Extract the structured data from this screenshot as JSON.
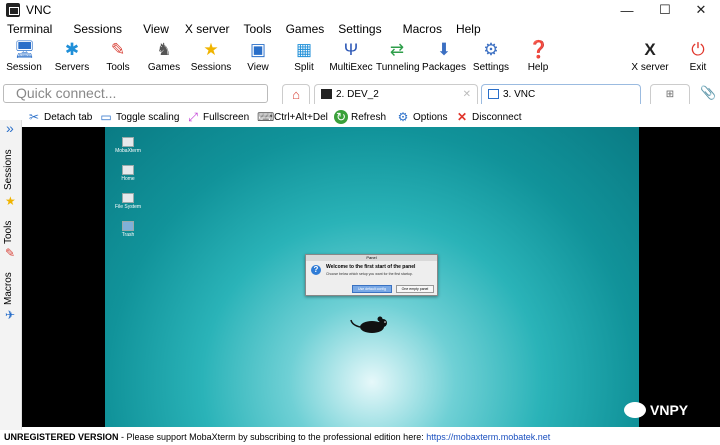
{
  "window": {
    "title": "VNC",
    "minimize": "—",
    "maximize": "☐",
    "close": "✕"
  },
  "menu": [
    "Terminal",
    "Sessions",
    "View",
    "X server",
    "Tools",
    "Games",
    "Settings",
    "Macros",
    "Help"
  ],
  "toolbar": [
    {
      "label": "Session",
      "icon": "session-icon"
    },
    {
      "label": "Servers",
      "icon": "servers-icon"
    },
    {
      "label": "Tools",
      "icon": "tools-icon"
    },
    {
      "label": "Games",
      "icon": "games-icon"
    },
    {
      "label": "Sessions",
      "icon": "star-icon"
    },
    {
      "label": "View",
      "icon": "view-icon"
    },
    {
      "label": "Split",
      "icon": "split-icon"
    },
    {
      "label": "MultiExec",
      "icon": "multiexec-icon"
    },
    {
      "label": "Tunneling",
      "icon": "tunneling-icon"
    },
    {
      "label": "Packages",
      "icon": "packages-icon"
    },
    {
      "label": "Settings",
      "icon": "settings-icon"
    },
    {
      "label": "Help",
      "icon": "help-icon"
    },
    {
      "label": "X server",
      "icon": "x-server-icon"
    },
    {
      "label": "Exit",
      "icon": "power-icon"
    }
  ],
  "quick_connect": {
    "placeholder": "Quick connect..."
  },
  "tabs": [
    {
      "label": "2. DEV_2"
    },
    {
      "label": "3. VNC"
    }
  ],
  "vnc_toolbar": [
    "Detach tab",
    "Toggle scaling",
    "Fullscreen",
    "Ctrl+Alt+Del",
    "Refresh",
    "Options",
    "Disconnect"
  ],
  "side_tabs": [
    "Sessions",
    "Tools",
    "Macros"
  ],
  "desktop": {
    "icons": [
      "MobaXterm",
      "Home",
      "File System",
      "Trash"
    ],
    "dialog": {
      "title": "Panel",
      "heading": "Welcome to the first start of the panel",
      "message": "Choose below which setup you want for the first startup.",
      "btn_default": "Use default config",
      "btn_empty": "One empty panel"
    }
  },
  "status": {
    "prefix": "UNREGISTERED VERSION",
    "message": " - Please support MobaXterm by subscribing to the professional edition here: ",
    "link": "https://mobaxterm.mobatek.net"
  },
  "watermark": "VNPY"
}
